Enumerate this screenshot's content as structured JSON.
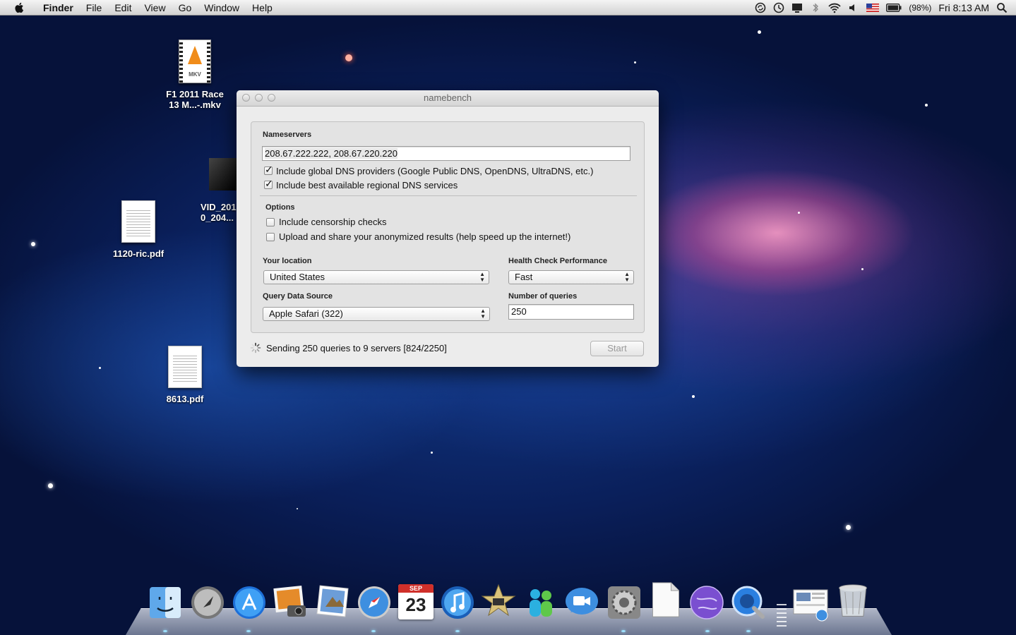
{
  "menubar": {
    "app_name": "Finder",
    "items": [
      "File",
      "Edit",
      "View",
      "Go",
      "Window",
      "Help"
    ],
    "battery": "(98%)",
    "clock": "Fri 8:13 AM"
  },
  "desktop": {
    "icons": [
      {
        "label_line1": "F1 2011 Race",
        "label_line2": "13 M...-.mkv",
        "badge": "MKV"
      },
      {
        "label_line1": "VID_201",
        "label_line2": "0_204..."
      },
      {
        "label_line1": "1120-ric.pdf"
      },
      {
        "label_line1": "8613.pdf"
      }
    ]
  },
  "window": {
    "title": "namebench",
    "nameservers_label": "Nameservers",
    "nameservers_value": "208.67.222.222, 208.67.220.220",
    "include_global": "Include global DNS providers (Google Public DNS, OpenDNS, UltraDNS, etc.)",
    "include_regional": "Include best available regional DNS services",
    "options_label": "Options",
    "censorship": "Include censorship checks",
    "upload": "Upload and share your anonymized results (help speed up the internet!)",
    "location_label": "Your location",
    "location_value": "United States",
    "health_label": "Health Check Performance",
    "health_value": "Fast",
    "source_label": "Query Data Source",
    "source_value": "Apple Safari (322)",
    "queries_label": "Number of queries",
    "queries_value": "250",
    "status": "Sending 250 queries to 9 servers [824/2250]",
    "start_label": "Start"
  },
  "dock": {
    "calendar_month": "SEP",
    "calendar_day": "23",
    "apps": [
      "finder",
      "launchpad",
      "app-store",
      "iphoto",
      "preview",
      "safari",
      "ical",
      "itunes",
      "imovie",
      "messenger",
      "facetime",
      "system-preferences",
      "textedit",
      "globe",
      "quicktime",
      "documents-stack",
      "trash"
    ]
  },
  "colors": {
    "accent": "#3a7be0",
    "window_bg": "#ececec"
  }
}
